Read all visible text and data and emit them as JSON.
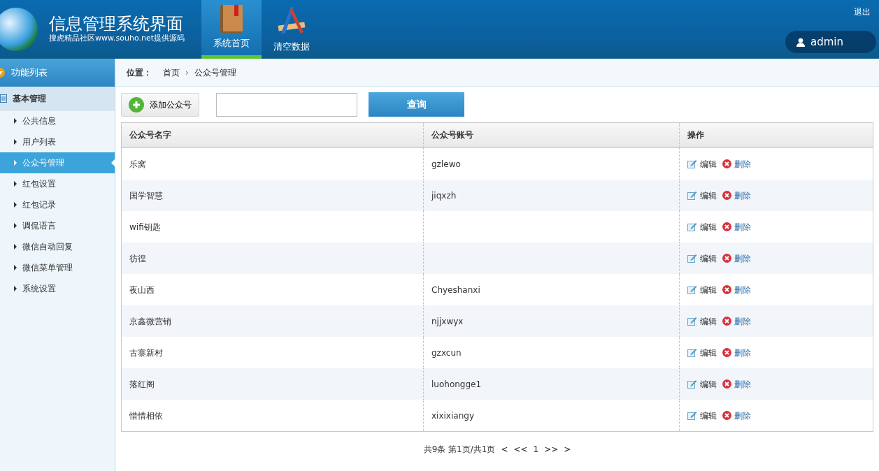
{
  "header": {
    "title": "信息管理系统界面",
    "subtitle": "搜虎精品社区www.souho.net提供源码",
    "nav": [
      {
        "label": "系统首页",
        "kind": "book",
        "selected": true
      },
      {
        "label": "清空数据",
        "kind": "tools",
        "selected": false
      }
    ],
    "logout": "退出",
    "user": "admin"
  },
  "sidebar": {
    "title": "功能列表",
    "group": "基本管理",
    "items": [
      {
        "label": "公共信息",
        "selected": false
      },
      {
        "label": "用户列表",
        "selected": false
      },
      {
        "label": "公众号管理",
        "selected": true
      },
      {
        "label": "红包设置",
        "selected": false
      },
      {
        "label": "红包记录",
        "selected": false
      },
      {
        "label": "调侃语言",
        "selected": false
      },
      {
        "label": "微信自动回复",
        "selected": false
      },
      {
        "label": "微信菜单管理",
        "selected": false
      },
      {
        "label": "系统设置",
        "selected": false
      }
    ]
  },
  "breadcrumb": {
    "label": "位置：",
    "items": [
      "首页",
      "公众号管理"
    ],
    "separator": "›"
  },
  "toolbar": {
    "add_button": "添加公众号",
    "search_button": "查询"
  },
  "table": {
    "columns": [
      "公众号名字",
      "公众号账号",
      "操作"
    ],
    "rows": [
      {
        "name": "乐窝",
        "account": "gzlewo",
        "edit": "编辑",
        "delete": "删除"
      },
      {
        "name": "国学智慧",
        "account": "jiqxzh",
        "edit": "编辑",
        "delete": "删除"
      },
      {
        "name": "wifi钥匙",
        "edit": "编辑",
        "delete": "删除"
      },
      {
        "name": "彷徨",
        "edit": "编辑",
        "delete": "删除"
      },
      {
        "name": "夜山西",
        "account": "Chyeshanxi",
        "edit": "编辑",
        "delete": "删除"
      },
      {
        "name": "京鑫微营销",
        "account": "njjxwyx",
        "edit": "编辑",
        "delete": "删除"
      },
      {
        "name": "古寨新村",
        "account": "gzxcun",
        "edit": "编辑",
        "delete": "删除"
      },
      {
        "name": "落红阁",
        "account": "luohongge1",
        "edit": "编辑",
        "delete": "删除"
      },
      {
        "name": "惜惜相依",
        "account": "xixixiangy",
        "edit": "编辑",
        "delete": "删除"
      }
    ]
  },
  "pagination": {
    "summary": "共9条 第1页/共1页",
    "first": "<",
    "prev": "<<",
    "page": "1",
    "next": ">>",
    "last": ">"
  }
}
